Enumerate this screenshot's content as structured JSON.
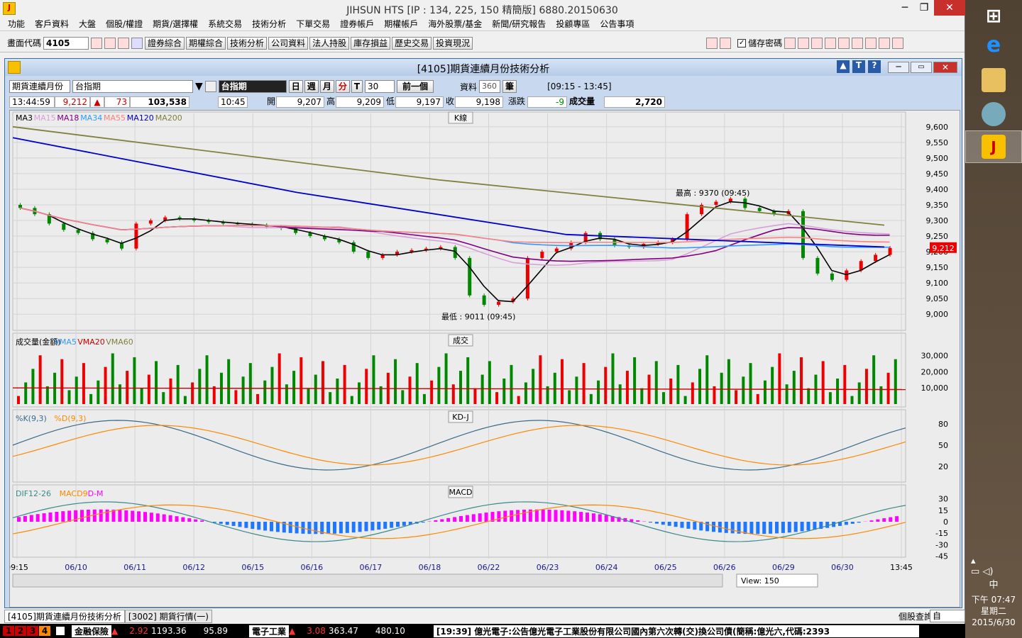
{
  "window": {
    "title": "JIHSUN HTS     [IP : 134, 225, 150 精簡版] 6880.20150630"
  },
  "menu": [
    "功能",
    "客戶資料",
    "大盤",
    "個股/權證",
    "期貨/選擇權",
    "系統交易",
    "技術分析",
    "下單交易",
    "證券帳戶",
    "期權帳戶",
    "海外股票/基金",
    "新聞/研究報告",
    "投顧專區",
    "公告事項"
  ],
  "toolbar": {
    "code_label": "畫面代碼",
    "code_value": "4105",
    "buttons": [
      "證券綜合",
      "期權綜合",
      "技術分析",
      "公司資料",
      "法人持股",
      "庫存損益",
      "歷史交易",
      "投資現況"
    ],
    "save_pw": "儲存密碼"
  },
  "inner": {
    "title": "[4105]期貨連續月份技術分析"
  },
  "controls": {
    "product_type": "期貨連續月份",
    "product_name": "台指期",
    "symbol": "台指期",
    "periods": [
      "日",
      "週",
      "月",
      "分",
      "T"
    ],
    "interval": "30",
    "prev_btn": "前一個",
    "data_label": "資料",
    "data_count": "360",
    "unit": "筆",
    "session": "[09:15 - 13:45]"
  },
  "quote": {
    "time": "13:44:59",
    "price": "9,212",
    "change": "73",
    "volume_total": "103,538",
    "bar_time": "10:45",
    "open_label": "開",
    "open": "9,207",
    "high_label": "高",
    "high": "9,209",
    "low_label": "低",
    "low": "9,197",
    "close_label": "收",
    "close": "9,198",
    "chg_label": "漲跌",
    "chg": "-9",
    "vol_label": "成交量",
    "vol": "2,720"
  },
  "panels": {
    "k_title": "K線",
    "vol_title": "成交",
    "kd_title": "KD-J",
    "macd_title": "MACD"
  },
  "legends": {
    "ma": [
      {
        "t": "MA3",
        "c": "#000000"
      },
      {
        "t": "MA15",
        "c": "#d8a0d8"
      },
      {
        "t": "MA18",
        "c": "#800080"
      },
      {
        "t": "MA34",
        "c": "#3399ff"
      },
      {
        "t": "MA55",
        "c": "#ff8080"
      },
      {
        "t": "MA120",
        "c": "#0000cc"
      },
      {
        "t": "MA200",
        "c": "#808040"
      }
    ],
    "vol": [
      {
        "t": "成交量(金額)",
        "c": "#000000"
      },
      {
        "t": "VMA5",
        "c": "#3399ff"
      },
      {
        "t": "VMA20",
        "c": "#cc0000"
      },
      {
        "t": "VMA60",
        "c": "#808040"
      }
    ],
    "kd": [
      {
        "t": "%K(9,3)",
        "c": "#3a6a8a"
      },
      {
        "t": "%D(9,3)",
        "c": "#ff8800"
      }
    ],
    "macd": [
      {
        "t": "DIF12-26",
        "c": "#3a8a8a"
      },
      {
        "t": "MACD9",
        "c": "#ff8800"
      },
      {
        "t": "D-M",
        "c": "#ff00ff"
      }
    ]
  },
  "annotations": {
    "high": "最高 : 9370 (09:45)",
    "low": "最低 : 9011 (09:45)",
    "last_price": "9,212"
  },
  "chart_data": {
    "type": "candlestick",
    "price_axis": [
      9600,
      9550,
      9500,
      9450,
      9400,
      9350,
      9300,
      9250,
      9200,
      9150,
      9100,
      9050,
      9000
    ],
    "price_ylim": [
      8980,
      9620
    ],
    "x_dates": [
      "09:15",
      "06/10",
      "06/11",
      "06/12",
      "06/15",
      "06/16",
      "06/17",
      "06/18",
      "06/22",
      "06/23",
      "06/24",
      "06/25",
      "06/26",
      "06/29",
      "06/30",
      "13:45"
    ],
    "close": [
      9340,
      9320,
      9290,
      9270,
      9260,
      9240,
      9230,
      9210,
      9290,
      9300,
      9310,
      9305,
      9300,
      9295,
      9290,
      9288,
      9285,
      9280,
      9275,
      9260,
      9250,
      9240,
      9230,
      9200,
      9180,
      9190,
      9200,
      9205,
      9210,
      9215,
      9180,
      9060,
      9030,
      9040,
      9050,
      9180,
      9200,
      9210,
      9230,
      9260,
      9240,
      9220,
      9215,
      9225,
      9230,
      9240,
      9320,
      9350,
      9360,
      9370,
      9340,
      9330,
      9320,
      9330,
      9180,
      9130,
      9110,
      9140,
      9170,
      9190,
      9212
    ],
    "volume_axis": [
      30000,
      20000,
      10000
    ],
    "kd_axis": [
      80,
      50,
      20
    ],
    "macd_axis": [
      30,
      15,
      0,
      -15,
      -30,
      -45
    ],
    "view_count": "150"
  },
  "footer": {
    "tabs": [
      "[4105]期貨連續月份技術分析",
      "[3002] 期貨行情(一)"
    ],
    "query": "個股查詢",
    "submit": "自"
  },
  "ticker": {
    "pages": [
      "1",
      "2",
      "3",
      "4"
    ],
    "name1": "金融保險",
    "chg1": "2.92",
    "idx1": "1193.36",
    "val1": "95.89",
    "name2": "電子工業",
    "chg2": "3.08",
    "idx2": "363.47",
    "val2": "480.10",
    "news": "[19:39] 億光電子:公告億光電子工業股份有限公司國內第六次轉(交)換公司債(簡稱:億光六,代碼:2393"
  },
  "taskbar": {
    "time": "下午 07:47",
    "weekday": "星期二",
    "date": "2015/6/30",
    "ime": "中"
  }
}
